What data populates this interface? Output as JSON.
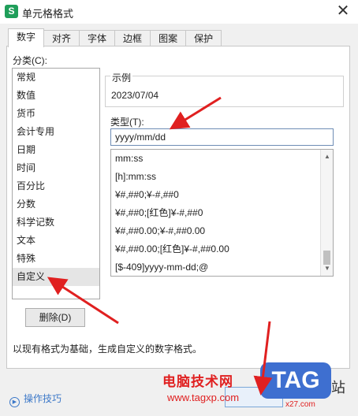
{
  "window": {
    "title": "单元格格式",
    "app_icon_letter": "S",
    "close_glyph": "✕"
  },
  "tabs": [
    {
      "label": "数字",
      "active": true
    },
    {
      "label": "对齐"
    },
    {
      "label": "字体"
    },
    {
      "label": "边框"
    },
    {
      "label": "图案"
    },
    {
      "label": "保护"
    }
  ],
  "category": {
    "label": "分类(C):",
    "items": [
      "常规",
      "数值",
      "货币",
      "会计专用",
      "日期",
      "时间",
      "百分比",
      "分数",
      "科学记数",
      "文本",
      "特殊",
      "自定义"
    ],
    "selected_index": 11
  },
  "sample": {
    "label": "示例",
    "value": "2023/07/04"
  },
  "type": {
    "label": "类型(T):",
    "value": "yyyy/mm/dd",
    "list": [
      "mm:ss",
      "[h]:mm:ss",
      "¥#,##0;¥-#,##0",
      "¥#,##0;[红色]¥-#,##0",
      "¥#,##0.00;¥-#,##0.00",
      "¥#,##0.00;[红色]¥-#,##0.00",
      "[$-409]yyyy-mm-dd;@"
    ]
  },
  "buttons": {
    "delete": "删除(D)"
  },
  "description": "以现有格式为基础，生成自定义的数字格式。",
  "footer": {
    "tips_label": "操作技巧"
  },
  "watermark": {
    "site_name": "电脑技术网",
    "url": "www.tagxp.com",
    "logo": "TAG",
    "suffix": "站",
    "sub": "x27.com"
  },
  "colors": {
    "arrow": "#e02020",
    "accent": "#3c78c8"
  }
}
